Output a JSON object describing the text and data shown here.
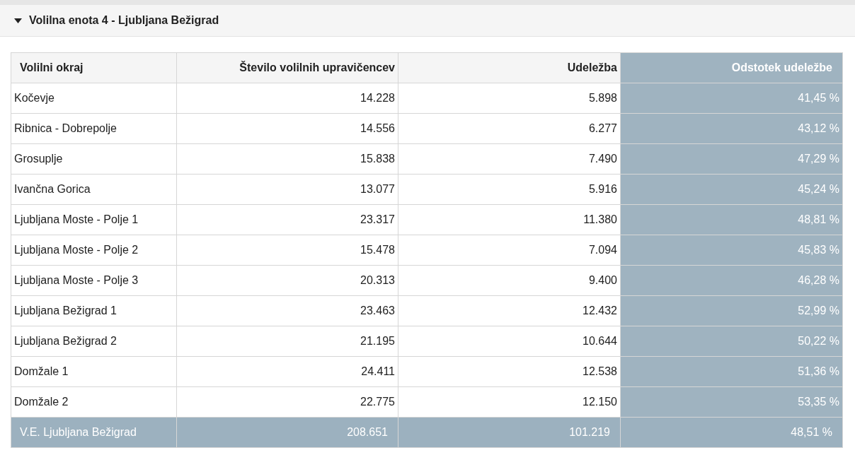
{
  "section": {
    "title": "Volilna enota 4 - Ljubljana Bežigrad",
    "expanded": true
  },
  "table": {
    "columns": [
      "Volilni okraj",
      "Število volilnih upravičencev",
      "Udeležba",
      "Odstotek udeležbe"
    ],
    "rows": [
      [
        "Kočevje",
        "14.228",
        "5.898",
        "41,45 %"
      ],
      [
        "Ribnica - Dobrepolje",
        "14.556",
        "6.277",
        "43,12 %"
      ],
      [
        "Grosuplje",
        "15.838",
        "7.490",
        "47,29 %"
      ],
      [
        "Ivančna Gorica",
        "13.077",
        "5.916",
        "45,24 %"
      ],
      [
        "Ljubljana Moste - Polje 1",
        "23.317",
        "11.380",
        "48,81 %"
      ],
      [
        "Ljubljana Moste - Polje 2",
        "15.478",
        "7.094",
        "45,83 %"
      ],
      [
        "Ljubljana Moste - Polje 3",
        "20.313",
        "9.400",
        "46,28 %"
      ],
      [
        "Ljubljana Bežigrad 1",
        "23.463",
        "12.432",
        "52,99 %"
      ],
      [
        "Ljubljana Bežigrad 2",
        "21.195",
        "10.644",
        "50,22 %"
      ],
      [
        "Domžale 1",
        "24.411",
        "12.538",
        "51,36 %"
      ],
      [
        "Domžale 2",
        "22.775",
        "12.150",
        "53,35 %"
      ]
    ],
    "total": [
      "V.E. Ljubljana Bežigrad",
      "208.651",
      "101.219",
      "48,51 %"
    ]
  }
}
